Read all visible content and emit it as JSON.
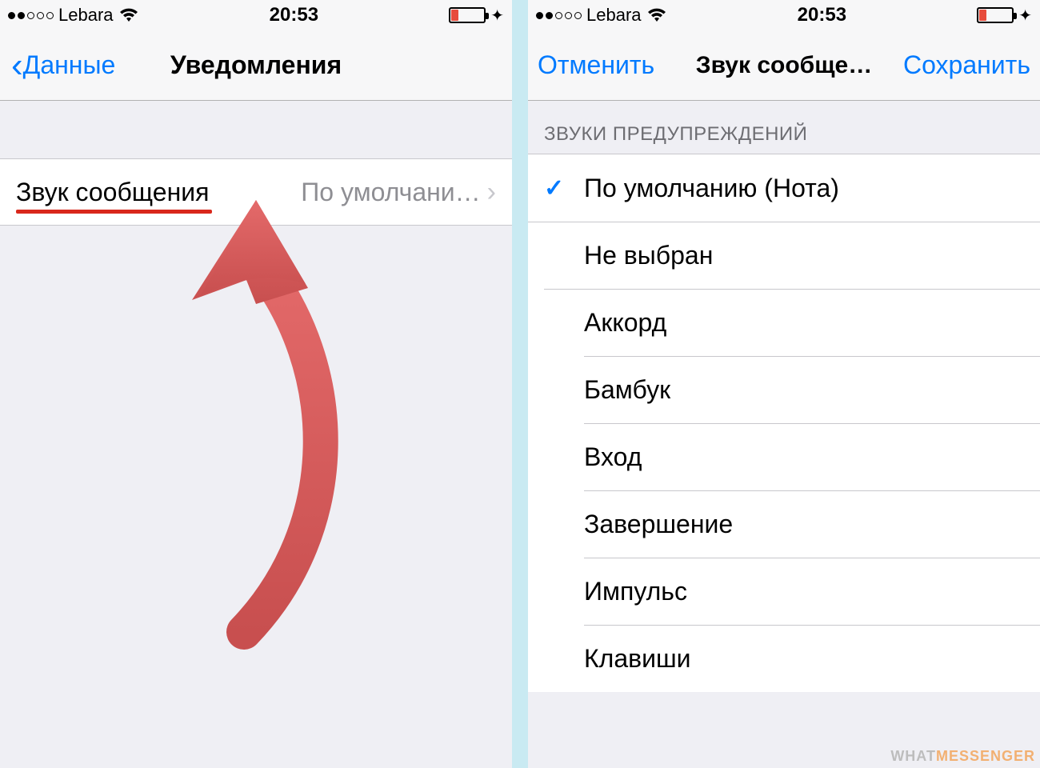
{
  "status": {
    "carrier": "Lebara",
    "time": "20:53"
  },
  "left": {
    "nav_back": "Данные",
    "nav_title": "Уведомления",
    "row_label": "Звук сообщения",
    "row_value": "По умолчани…"
  },
  "right": {
    "nav_cancel": "Отменить",
    "nav_title": "Звук сообще…",
    "nav_save": "Сохранить",
    "section_header": "ЗВУКИ ПРЕДУПРЕЖДЕНИЙ",
    "items": [
      "По умолчанию (Нота)",
      "Не выбран",
      "Аккорд",
      "Бамбук",
      "Вход",
      "Завершение",
      "Импульс",
      "Клавиши"
    ],
    "selected_index": 0
  },
  "watermark_a": "WHAT",
  "watermark_b": "MESSENGER"
}
